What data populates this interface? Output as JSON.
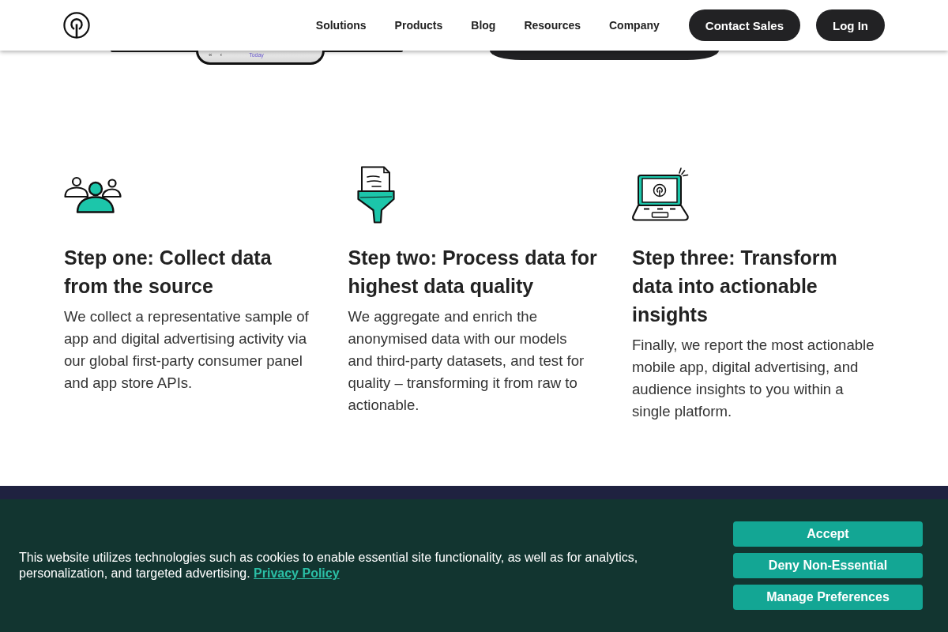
{
  "header": {
    "nav": [
      {
        "label": "Solutions"
      },
      {
        "label": "Products"
      },
      {
        "label": "Blog"
      },
      {
        "label": "Resources"
      },
      {
        "label": "Company"
      }
    ],
    "buttons": [
      {
        "label": "Contact Sales"
      },
      {
        "label": "Log In"
      }
    ]
  },
  "hero": {
    "phone_nav": [
      {
        "label": "«"
      },
      {
        "label": "‹"
      },
      {
        "label": "Today"
      }
    ]
  },
  "steps": [
    {
      "kind": "people",
      "title": "Step one: Collect data from the source",
      "text": "We collect a representative sample of app and digital advertising activity via our global first-party consumer panel and app store APIs."
    },
    {
      "kind": "funnel",
      "title": "Step two: Process data for highest data quality",
      "text": "We aggregate and enrich the anonymised data with our models and third-party datasets, and test for quality – transforming it from raw to actionable."
    },
    {
      "kind": "laptop",
      "title": "Step three: Transform data into actionable insights",
      "text": "Finally, we report the most actionable mobile app, digital advertising, and audience insights to you within a single platform."
    }
  ],
  "cookie_banner": {
    "text": "This website utilizes technologies such as cookies to enable essential site functionality, as well as for analytics, personalization, and targeted advertising.",
    "link": "Privacy Policy",
    "buttons": [
      {
        "label": "Accept"
      },
      {
        "label": "Deny Non-Essential"
      },
      {
        "label": "Manage Preferences"
      }
    ]
  }
}
